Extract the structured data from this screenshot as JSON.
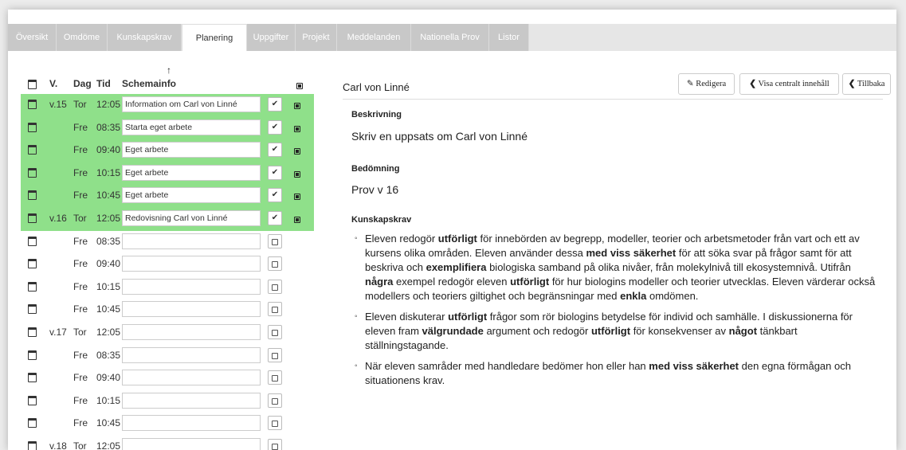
{
  "tabs": [
    "Översikt",
    "Omdöme",
    "Kunskapskrav",
    "Planering",
    "Uppgifter",
    "Projekt",
    "Meddelanden",
    "Nationella Prov",
    "Listor"
  ],
  "active_tab": "Planering",
  "sort_indicator": "↑",
  "table": {
    "headers": {
      "week": "V.",
      "day": "Dag",
      "time": "Tid",
      "info": "Schemainfo"
    },
    "rows": [
      {
        "week": "v.15",
        "day": "Tor",
        "time": "12:05",
        "info": "Information om Carl von Linné",
        "checked": true
      },
      {
        "week": "",
        "day": "Fre",
        "time": "08:35",
        "info": "Starta eget arbete",
        "checked": true
      },
      {
        "week": "",
        "day": "Fre",
        "time": "09:40",
        "info": "Eget arbete",
        "checked": true
      },
      {
        "week": "",
        "day": "Fre",
        "time": "10:15",
        "info": "Eget arbete",
        "checked": true
      },
      {
        "week": "",
        "day": "Fre",
        "time": "10:45",
        "info": "Eget arbete",
        "checked": true
      },
      {
        "week": "v.16",
        "day": "Tor",
        "time": "12:05",
        "info": "Redovisning Carl von Linné",
        "checked": true
      },
      {
        "week": "",
        "day": "Fre",
        "time": "08:35",
        "info": "",
        "checked": false
      },
      {
        "week": "",
        "day": "Fre",
        "time": "09:40",
        "info": "",
        "checked": false
      },
      {
        "week": "",
        "day": "Fre",
        "time": "10:15",
        "info": "",
        "checked": false
      },
      {
        "week": "",
        "day": "Fre",
        "time": "10:45",
        "info": "",
        "checked": false
      },
      {
        "week": "v.17",
        "day": "Tor",
        "time": "12:05",
        "info": "",
        "checked": false
      },
      {
        "week": "",
        "day": "Fre",
        "time": "08:35",
        "info": "",
        "checked": false
      },
      {
        "week": "",
        "day": "Fre",
        "time": "09:40",
        "info": "",
        "checked": false
      },
      {
        "week": "",
        "day": "Fre",
        "time": "10:15",
        "info": "",
        "checked": false
      },
      {
        "week": "",
        "day": "Fre",
        "time": "10:45",
        "info": "",
        "checked": false
      },
      {
        "week": "v.18",
        "day": "Tor",
        "time": "12:05",
        "info": "",
        "checked": false
      }
    ]
  },
  "detail": {
    "title": "Carl von Linné",
    "buttons": {
      "edit": "Redigera",
      "central": "Visa centralt innehåll",
      "back": "Tillbaka"
    },
    "description_label": "Beskrivning",
    "description": "Skriv en uppsats om Carl von Linné",
    "assessment_label": "Bedömning",
    "assessment": "Prov v 16",
    "requirements_label": "Kunskapskrav",
    "requirements_html": [
      "Eleven redogör <b>utförligt</b> för innebörden av begrepp, modeller, teorier och arbetsmetoder från vart och ett av kursens olika områden. Eleven använder dessa <b>med viss säkerhet</b> för att söka svar på frågor samt för att beskriva och <b>exemplifiera</b> biologiska samband på olika nivåer, från molekylnivå till ekosystemnivå. Utifrån <b>några</b> exempel redogör eleven <b>utförligt</b> för hur biologins modeller och teorier utvecklas. Eleven värderar också modellers och teoriers giltighet och begränsningar med <b>enkla</b> omdömen.",
      "Eleven diskuterar <b>utförligt</b> frågor som rör biologins betydelse för individ och samhälle. I diskussionerna för eleven fram <b>välgrundade</b> argument och redogör <b>utförligt</b> för konsekvenser av <b>något</b> tänkbart ställningstagande.",
      "När eleven samråder med handledare bedömer hon eller han <b>med viss säkerhet</b> den egna förmågan och situationens krav."
    ]
  },
  "colors": {
    "highlight": "#8fe08a",
    "tab_inactive": "#c8c8c8"
  }
}
